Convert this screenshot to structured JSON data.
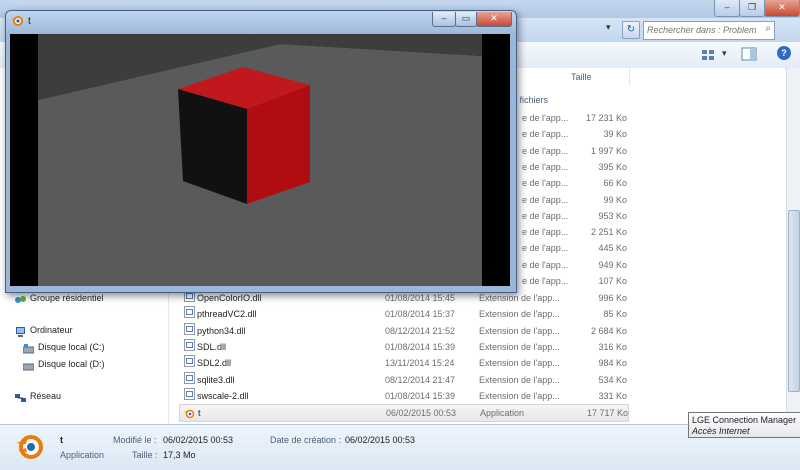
{
  "explorer": {
    "search_placeholder": "Rechercher dans : Problem",
    "col_size_header": "Taille",
    "group_label": "e fichiers",
    "partial_rows": [
      {
        "type": "e de l'app...",
        "size": "17 231 Ko"
      },
      {
        "type": "e de l'app...",
        "size": "39 Ko"
      },
      {
        "type": "e de l'app...",
        "size": "1 997 Ko"
      },
      {
        "type": "e de l'app...",
        "size": "395 Ko"
      },
      {
        "type": "e de l'app...",
        "size": "66 Ko"
      },
      {
        "type": "e de l'app...",
        "size": "99 Ko"
      },
      {
        "type": "e de l'app...",
        "size": "953 Ko"
      },
      {
        "type": "e de l'app...",
        "size": "2 251 Ko"
      },
      {
        "type": "e de l'app...",
        "size": "445 Ko"
      },
      {
        "type": "e de l'app...",
        "size": "949 Ko"
      },
      {
        "type": "e de l'app...",
        "size": "107 Ko"
      }
    ],
    "files": [
      {
        "name": "OpenColorIO.dll",
        "date": "01/08/2014 15:45",
        "type": "Extension de l'app...",
        "size": "996 Ko"
      },
      {
        "name": "pthreadVC2.dll",
        "date": "01/08/2014 15:37",
        "type": "Extension de l'app...",
        "size": "85 Ko"
      },
      {
        "name": "python34.dll",
        "date": "08/12/2014 21:52",
        "type": "Extension de l'app...",
        "size": "2 684 Ko"
      },
      {
        "name": "SDL.dll",
        "date": "01/08/2014 15:39",
        "type": "Extension de l'app...",
        "size": "316 Ko"
      },
      {
        "name": "SDL2.dll",
        "date": "13/11/2014 15:24",
        "type": "Extension de l'app...",
        "size": "984 Ko"
      },
      {
        "name": "sqlite3.dll",
        "date": "08/12/2014 21:47",
        "type": "Extension de l'app...",
        "size": "534 Ko"
      },
      {
        "name": "swscale-2.dll",
        "date": "01/08/2014 15:39",
        "type": "Extension de l'app...",
        "size": "331 Ko"
      },
      {
        "name": "t",
        "date": "06/02/2015 00:53",
        "type": "Application",
        "size": "17 717 Ko"
      }
    ],
    "nav": {
      "homegroup": "Groupe résidentiel",
      "computer": "Ordinateur",
      "disk_c": "Disque local (C:)",
      "disk_d": "Disque local (D:)",
      "network": "Réseau"
    },
    "details": {
      "name": "t",
      "kind": "Application",
      "modified_label": "Modifié le :",
      "modified_value": "06/02/2015 00:53",
      "size_label": "Taille :",
      "size_value": "17,3 Mo",
      "created_label": "Date de création :",
      "created_value": "06/02/2015 00:53"
    }
  },
  "app_window": {
    "title": "t"
  },
  "tooltip": {
    "title": "LGE Connection Manager",
    "subtitle": "Accès Internet"
  },
  "colors": {
    "cube_front": "#b00d12",
    "cube_side": "#111111",
    "cube_top": "#c0181c",
    "floor": "#5a5a5a",
    "wall": "#3d3d3d"
  }
}
